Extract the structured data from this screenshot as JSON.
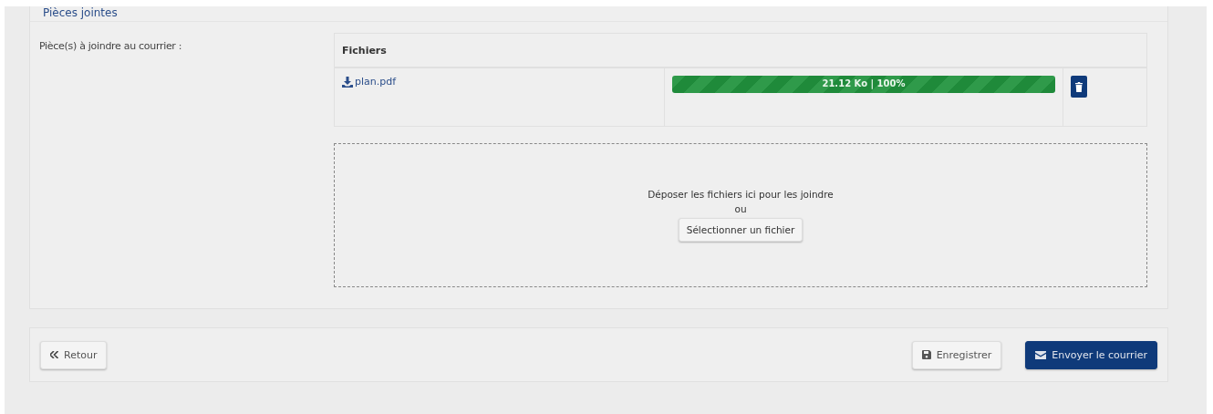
{
  "section": {
    "title": "Pièces jointes",
    "field_label": "Pièce(s) à joindre au courrier :"
  },
  "files_table": {
    "columns": [
      "Fichiers"
    ],
    "rows": [
      {
        "name": "plan.pdf",
        "level": 1,
        "reading": "21.12 Ko | 100%"
      }
    ]
  },
  "dropzone": {
    "hint": "Déposer les fichiers ici pour les joindre",
    "separator": "ou",
    "button": "Sélectionner un fichier"
  },
  "footer": {
    "back": "Retour",
    "save": "Enregistrer",
    "send": "Envoyer le courrier"
  }
}
